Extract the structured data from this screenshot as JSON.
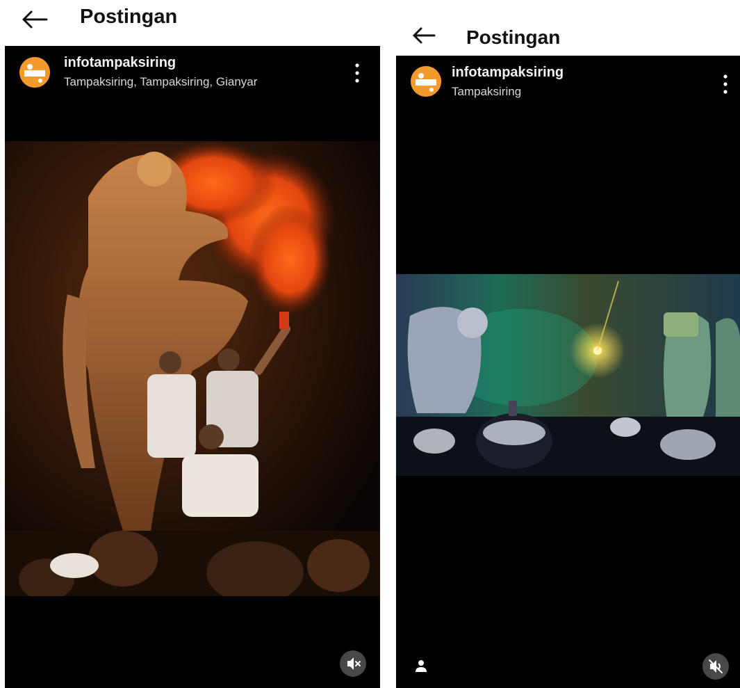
{
  "left": {
    "header": {
      "title": "Postingan"
    },
    "post": {
      "username": "infotampaksiring",
      "location": "Tampaksiring, Tampaksiring, Gianyar",
      "icons": {
        "back": "back-arrow-icon",
        "more": "more-vertical-icon",
        "mute": "muted-speaker-icon"
      }
    }
  },
  "right": {
    "header": {
      "title": "Postingan"
    },
    "post": {
      "username": "infotampaksiring",
      "location": "Tampaksiring",
      "icons": {
        "back": "back-arrow-icon",
        "more": "more-vertical-icon",
        "tags": "person-icon",
        "mute": "muted-speaker-icon"
      }
    }
  },
  "colors": {
    "post_background": "#000000",
    "avatar": "#f39a2c",
    "text_primary": "#111111",
    "text_on_dark": "#f2f2f2"
  }
}
